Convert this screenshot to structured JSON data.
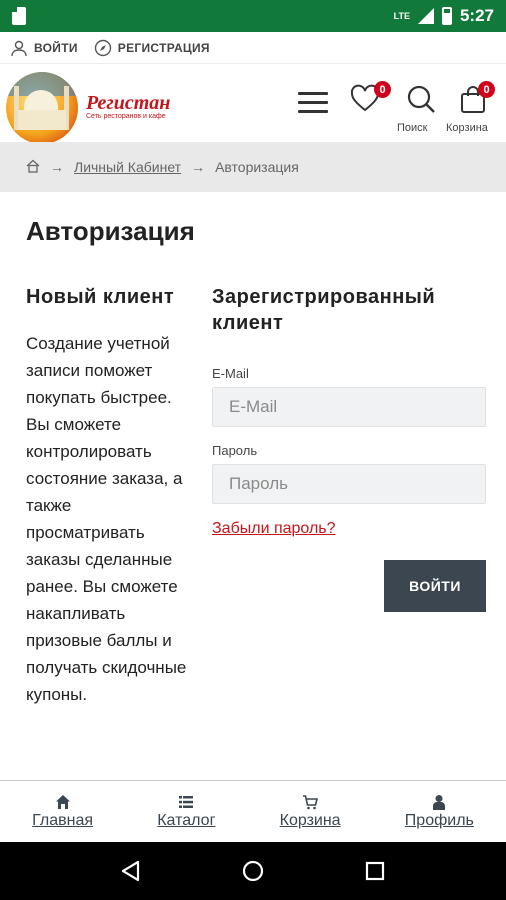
{
  "status_bar": {
    "network": "LTE",
    "time": "5:27"
  },
  "top_links": {
    "login": "ВОЙТИ",
    "register": "РЕГИСТРАЦИЯ"
  },
  "header": {
    "brand_name": "Регистан",
    "brand_tagline": "Сеть ресторанов и кафе",
    "wishlist_count": "0",
    "cart_count": "0",
    "search_label": "Поиск",
    "cart_label": "Корзина",
    "colors": {
      "brand_red": "#c4161c",
      "badge": "#d0021b"
    }
  },
  "breadcrumb": {
    "items": [
      "Личный Кабинет",
      "Авторизация"
    ]
  },
  "page": {
    "title": "Авторизация",
    "new_client": {
      "heading": "Новый клиент",
      "text": "Создание учетной записи поможет покупать быстрее. Вы сможете контролировать состояние заказа, а также просматривать заказы сделанные ранее. Вы сможете накапливать призовые баллы и получать скидочные купоны."
    },
    "registered_client": {
      "heading": "Зарегистрированный клиент",
      "email_label": "E-Mail",
      "email_placeholder": "E-Mail",
      "email_value": "",
      "password_label": "Пароль",
      "password_placeholder": "Пароль",
      "password_value": "",
      "forgot_link": "Забыли пароль?",
      "login_button": "ВОЙТИ",
      "button_color": "#3b4650"
    }
  },
  "bottom_nav": {
    "items": [
      {
        "label": "Главная",
        "icon": "home-icon"
      },
      {
        "label": "Каталог",
        "icon": "list-icon"
      },
      {
        "label": "Корзина",
        "icon": "cart-icon"
      },
      {
        "label": "Профиль",
        "icon": "user-icon"
      }
    ]
  },
  "system_nav": {
    "icons": [
      "back-icon",
      "home-circle-icon",
      "recents-icon"
    ]
  }
}
